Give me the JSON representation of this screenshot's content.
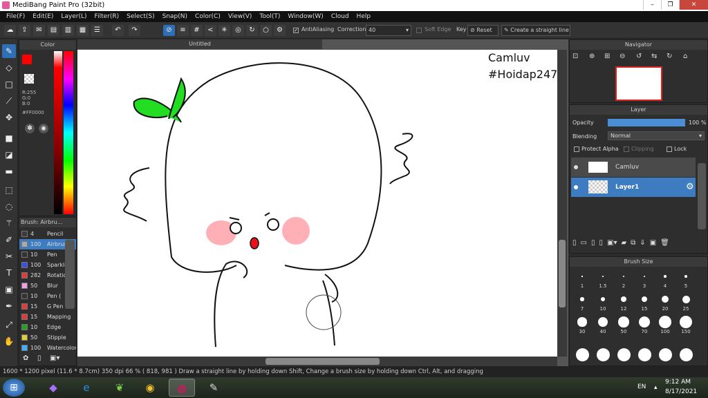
{
  "app": {
    "title": "MediBang Paint Pro (32bit)"
  },
  "menu": [
    "File(F)",
    "Edit(E)",
    "Layer(L)",
    "Filter(R)",
    "Select(S)",
    "Snap(N)",
    "Color(C)",
    "View(V)",
    "Tool(T)",
    "Window(W)",
    "Cloud",
    "Help"
  ],
  "toolbar": {
    "antialiasing_label": "AntiAliasing",
    "correction_label": "Correction",
    "correction_value": "40",
    "soft_edge_label": "Soft Edge",
    "key_label": "Key",
    "reset_label": "Reset",
    "straight_line_label": "Create a straight line"
  },
  "color_panel": {
    "title": "Color",
    "primary": "#ff0000",
    "secondary": "#000000",
    "r": "R:255",
    "g": "G:0",
    "b": "B:0",
    "hex": "#FF0000"
  },
  "brush_panel": {
    "title": "Brush: Airbru...",
    "items": [
      {
        "size": "4",
        "name": "Pencil",
        "color": "#3a3a3a"
      },
      {
        "size": "100",
        "name": "Airbrush",
        "color": "#aaaaaa"
      },
      {
        "size": "10",
        "name": "Pen",
        "color": "#333333"
      },
      {
        "size": "100",
        "name": "Sparkle",
        "color": "#3b4fe0"
      },
      {
        "size": "282",
        "name": "Rotation",
        "color": "#e03b3b"
      },
      {
        "size": "50",
        "name": "Blur",
        "color": "#f0a0e0"
      },
      {
        "size": "10",
        "name": "Pen (",
        "color": "#333333"
      },
      {
        "size": "15",
        "name": "G Pen",
        "color": "#e03b3b"
      },
      {
        "size": "15",
        "name": "Mapping",
        "color": "#e03b3b"
      },
      {
        "size": "10",
        "name": "Edge",
        "color": "#28a028"
      },
      {
        "size": "50",
        "name": "Stipple",
        "color": "#e0d030"
      },
      {
        "size": "100",
        "name": "Watercolor",
        "color": "#3fb0ff"
      }
    ]
  },
  "document": {
    "tab": "Untitled"
  },
  "canvas_text": {
    "line1": "Camluv",
    "line2": "#Hoidap247"
  },
  "navigator": {
    "title": "Navigator"
  },
  "layer_panel": {
    "title": "Layer",
    "opacity_label": "Opacity",
    "opacity_value": "100 %",
    "blending_label": "Blending",
    "blending_value": "Normal",
    "protect_alpha": "Protect Alpha",
    "clipping": "Clipping",
    "lock": "Lock",
    "layers": [
      {
        "name": "Camluv",
        "selected": false
      },
      {
        "name": "Layer1",
        "selected": true
      }
    ]
  },
  "brush_size_panel": {
    "title": "Brush Size",
    "sizes": [
      "1",
      "1.5",
      "2",
      "3",
      "4",
      "5",
      "7",
      "10",
      "12",
      "15",
      "20",
      "25",
      "30",
      "40",
      "50",
      "70",
      "100",
      "150"
    ]
  },
  "status": {
    "text": "1600 * 1200 pixel   (11.6 * 8.7cm)   350 dpi   66 %   ( 818, 981 )   Draw a straight line by holding down Shift, Change a brush size by holding down Ctrl, Alt, and dragging"
  },
  "taskbar": {
    "lang": "EN",
    "time": "9:12 AM",
    "date": "8/17/2021"
  },
  "colors": {
    "accent": "#2f6fb5",
    "selection": "#3d7cc0"
  }
}
